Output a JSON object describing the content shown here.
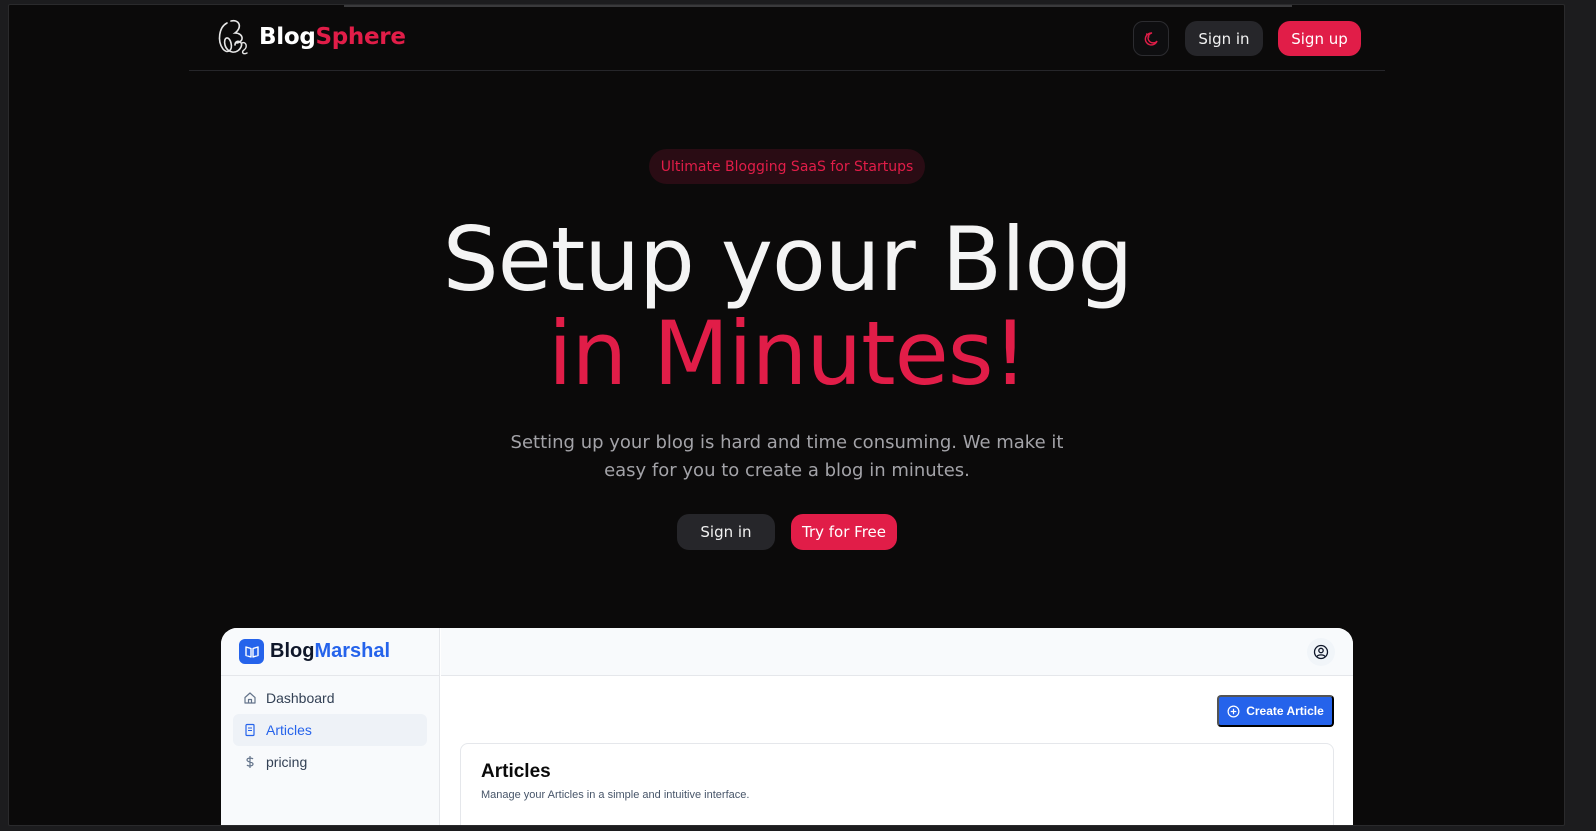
{
  "nav": {
    "brand_part1": "Blog",
    "brand_part2": "Sphere",
    "theme_toggle_icon": "moon-icon",
    "signin_label": "Sign in",
    "signup_label": "Sign up"
  },
  "hero": {
    "badge": "Ultimate Blogging SaaS for Startups",
    "title_line1": "Setup your Blog",
    "title_line2": "in Minutes!",
    "subtitle": "Setting up your blog is hard and time consuming. We make it easy for you to create a blog in minutes.",
    "signin_label": "Sign in",
    "try_label": "Try for Free"
  },
  "preview": {
    "brand_part1": "Blog",
    "brand_part2": "Marshal",
    "sidebar": {
      "items": [
        {
          "label": "Dashboard",
          "icon": "home-icon",
          "active": false
        },
        {
          "label": "Articles",
          "icon": "book-icon",
          "active": true
        },
        {
          "label": "pricing",
          "icon": "dollar-icon",
          "active": false
        }
      ]
    },
    "create_label": "Create Article",
    "card_title": "Articles",
    "card_subtitle": "Manage your Articles in a simple and intuitive interface."
  },
  "colors": {
    "accent": "#e11d48",
    "background": "#0b0a0a",
    "preview_accent": "#2563eb"
  }
}
